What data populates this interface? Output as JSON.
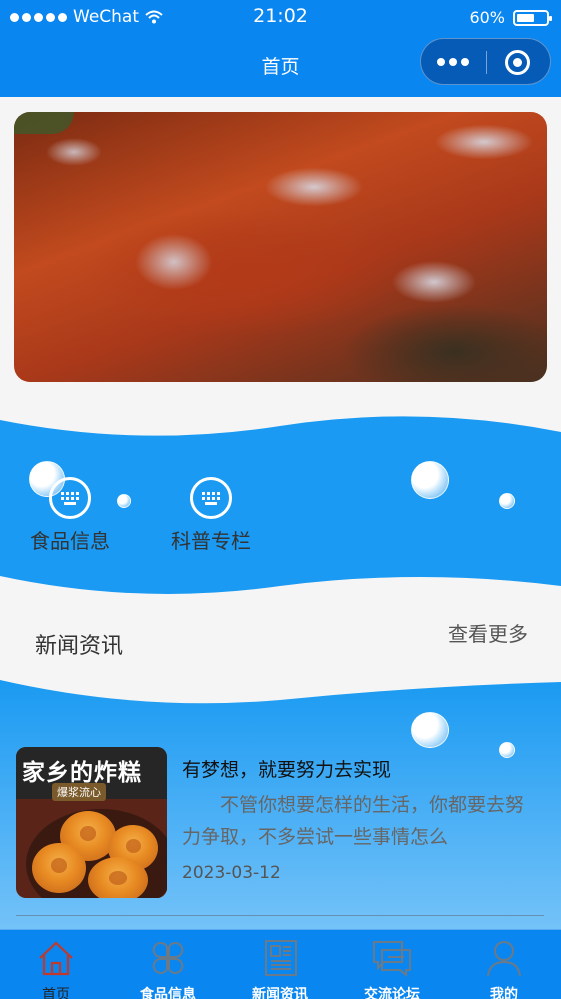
{
  "status": {
    "carrier": "WeChat",
    "time": "21:02",
    "battery": "60%",
    "battery_level": 0.6
  },
  "nav": {
    "title": "首页"
  },
  "menu": [
    {
      "label": "食品信息",
      "icon": "keyboard-icon"
    },
    {
      "label": "科普专栏",
      "icon": "keyboard-icon"
    }
  ],
  "news_section": {
    "title": "新闻资讯",
    "more": "查看更多"
  },
  "news": [
    {
      "title": "有梦想，就要努力去实现",
      "desc": "不管你想要怎样的生活，你都要去努力争取，不多尝试一些事情怎么",
      "date": "2023-03-12",
      "thumb_title": "家乡的炸糕",
      "thumb_tag": "爆浆流心"
    }
  ],
  "tabbar": [
    {
      "label": "首页",
      "icon": "home-icon",
      "active": true
    },
    {
      "label": "食品信息",
      "icon": "grid-icon",
      "active": false
    },
    {
      "label": "新闻资讯",
      "icon": "newspaper-icon",
      "active": false
    },
    {
      "label": "交流论坛",
      "icon": "chat-icon",
      "active": false
    },
    {
      "label": "我的",
      "icon": "user-icon",
      "active": false
    }
  ],
  "colors": {
    "primary": "#0a86f0",
    "wave": "#1a9af2",
    "active_tab": "#c0392b"
  }
}
